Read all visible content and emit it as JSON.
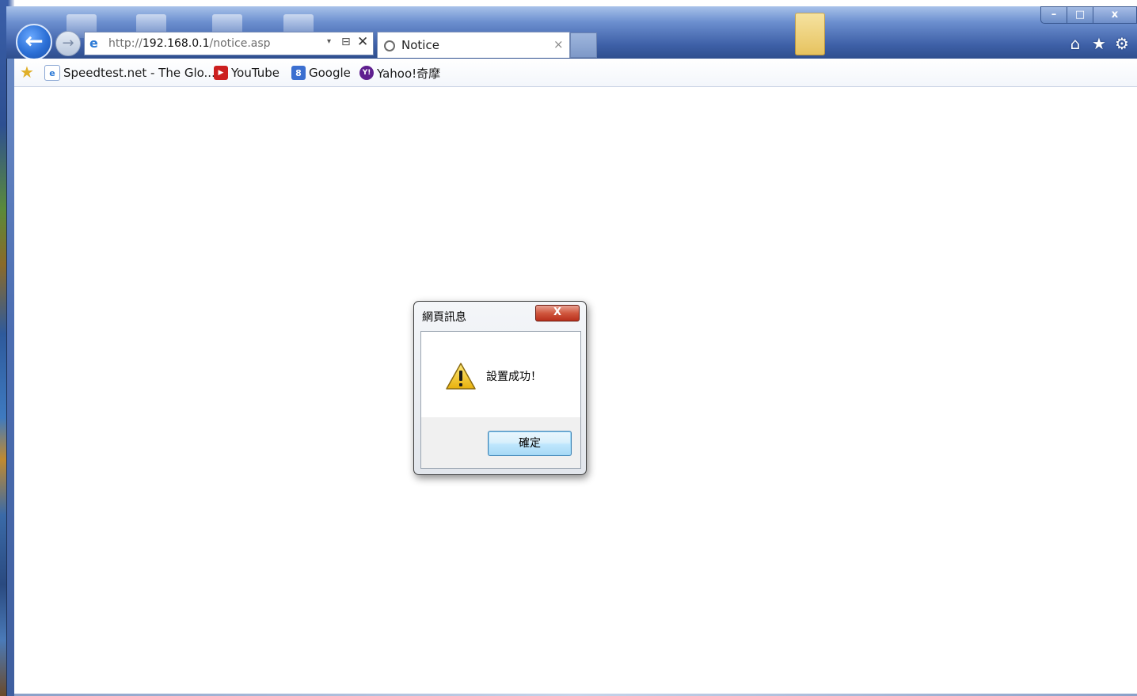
{
  "browser": {
    "address_url_prefix": "http://",
    "address_url_host": "192.168.0.1",
    "address_url_path": "/notice.asp",
    "tab_title": "Notice",
    "tab_close": "×",
    "stop_glyph": "✕",
    "compat_glyph": "⊟",
    "dropdown_glyph": "▾",
    "back_glyph": "←",
    "forward_glyph": "→",
    "window_controls": {
      "minimize": "–",
      "maximize": "□",
      "close": "x"
    },
    "tools": {
      "home": "⌂",
      "favorites": "★",
      "settings": "⚙"
    }
  },
  "favorites_bar": {
    "items": [
      {
        "label": "Speedtest.net - The Glo...",
        "icon": "ie-page-icon",
        "icon_color": "#2d7ad6",
        "icon_glyph": "e"
      },
      {
        "label": "YouTube",
        "icon": "youtube-icon",
        "icon_color": "#cc1f1f",
        "icon_glyph": "▶"
      },
      {
        "label": "Google",
        "icon": "google-icon",
        "icon_color": "#3b6fd0",
        "icon_glyph": "8"
      },
      {
        "label": "Yahoo!奇摩",
        "icon": "yahoo-icon",
        "icon_color": "#5f1f8f",
        "icon_glyph": "Y!"
      }
    ]
  },
  "dialog": {
    "title": "網頁訊息",
    "message": "設置成功！",
    "ok_label": "確定",
    "close_glyph": "X"
  },
  "colors": {
    "accent_blue": "#2b6fd6",
    "dialog_close_red": "#c43a24",
    "warning_yellow": "#f5c81f"
  }
}
